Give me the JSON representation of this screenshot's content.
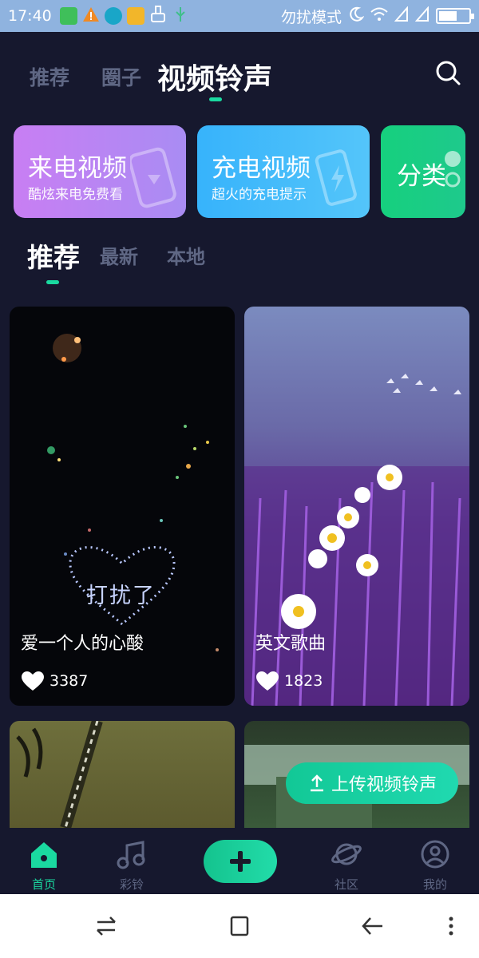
{
  "status_bar": {
    "time": "17:40",
    "dnd_text": "勿扰模式",
    "left_icons": [
      "app-icon",
      "warning-icon",
      "app-icon",
      "folder-icon",
      "cleaner-icon",
      "usb-icon"
    ],
    "right_icons": [
      "moon-icon",
      "wifi-icon",
      "signal-icon",
      "signal-icon",
      "battery-icon"
    ],
    "battery_level": 0.6
  },
  "top_tabs": [
    {
      "label": "推荐"
    },
    {
      "label": "圈子"
    },
    {
      "label": "视频铃声",
      "active": true
    }
  ],
  "feature_cards": [
    {
      "title": "来电视频",
      "subtitle": "酷炫来电免费看",
      "color_from": "#c87ef3",
      "color_to": "#a98cf3"
    },
    {
      "title": "充电视频",
      "subtitle": "超火的充电提示",
      "color_from": "#37b3fb",
      "color_to": "#54c5fa"
    },
    {
      "title": "分类",
      "subtitle": "",
      "color_from": "#16d07e",
      "color_to": "#1ec98c"
    }
  ],
  "sub_tabs": [
    {
      "label": "推荐",
      "active": true
    },
    {
      "label": "最新"
    },
    {
      "label": "本地"
    }
  ],
  "videos": [
    {
      "title": "爱一个人的心酸",
      "likes": "3387",
      "overlay_text": "打扰了"
    },
    {
      "title": "英文歌曲",
      "likes": "1823"
    },
    {
      "title": "",
      "likes": ""
    },
    {
      "title": "",
      "likes": ""
    }
  ],
  "upload_button": {
    "label": "上传视频铃声"
  },
  "bottom_nav": [
    {
      "label": "首页",
      "icon": "home-icon",
      "active": true
    },
    {
      "label": "彩铃",
      "icon": "music-note-icon"
    },
    {
      "label": "",
      "icon": "plus-icon"
    },
    {
      "label": "社区",
      "icon": "planet-icon"
    },
    {
      "label": "我的",
      "icon": "person-icon"
    }
  ],
  "colors": {
    "background": "#16182e",
    "accent": "#1ad9a0",
    "inactive_text": "#5f6784",
    "status_bar": "#8fb3df"
  }
}
